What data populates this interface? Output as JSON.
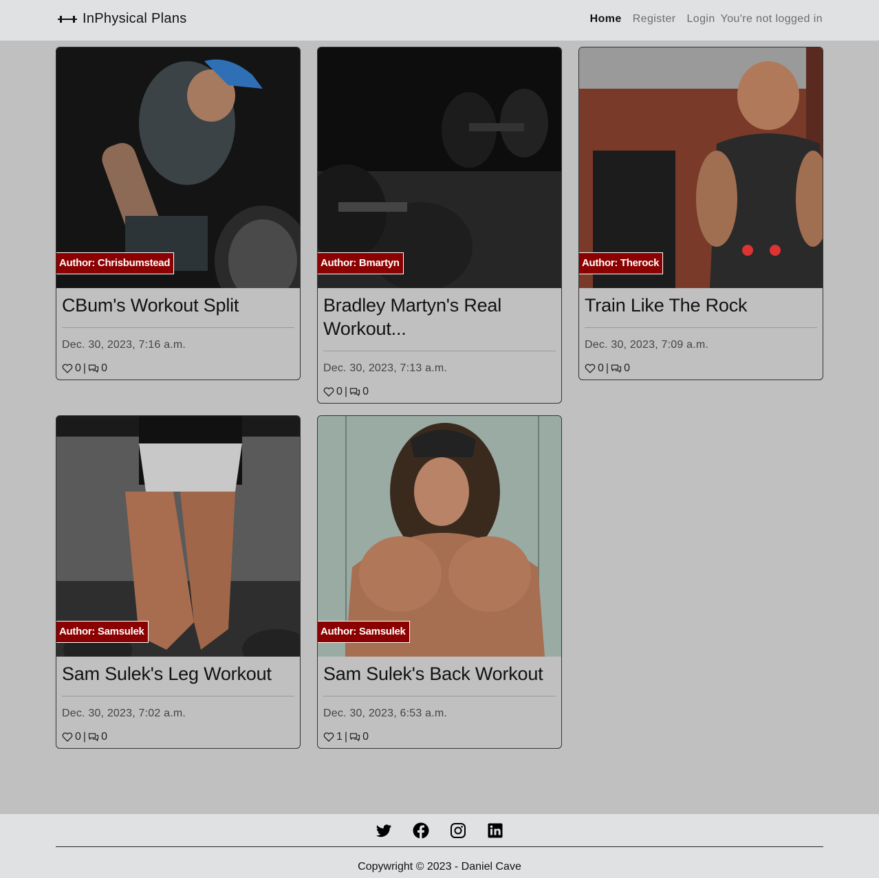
{
  "nav": {
    "brand": "InPhysical Plans",
    "links": [
      {
        "label": "Home",
        "active": true
      },
      {
        "label": "Register",
        "active": false
      },
      {
        "label": "Login",
        "active": false
      }
    ],
    "status": "You're not logged in"
  },
  "posts": [
    {
      "author": "Author: Chrisbumstead",
      "title": "CBum's Workout Split",
      "date": "Dec. 30, 2023, 7:16 a.m.",
      "likes": "0",
      "comments": "0"
    },
    {
      "author": "Author: Bmartyn",
      "title": "Bradley Martyn's Real Workout...",
      "date": "Dec. 30, 2023, 7:13 a.m.",
      "likes": "0",
      "comments": "0"
    },
    {
      "author": "Author: Therock",
      "title": "Train Like The Rock",
      "date": "Dec. 30, 2023, 7:09 a.m.",
      "likes": "0",
      "comments": "0"
    },
    {
      "author": "Author: Samsulek",
      "title": "Sam Sulek's Leg Workout",
      "date": "Dec. 30, 2023, 7:02 a.m.",
      "likes": "0",
      "comments": "0"
    },
    {
      "author": "Author: Samsulek",
      "title": "Sam Sulek's Back Workout",
      "date": "Dec. 30, 2023, 6:53 a.m.",
      "likes": "1",
      "comments": "0"
    }
  ],
  "meta_separator": "|",
  "footer": {
    "socials": [
      "twitter-icon",
      "facebook-icon",
      "instagram-icon",
      "linkedin-icon"
    ],
    "copyright": "Copywright © 2023 - Daniel Cave"
  },
  "colors": {
    "author_badge": "#8b0000",
    "background": "#c0c0c0",
    "bar": "#e0e1e3"
  }
}
